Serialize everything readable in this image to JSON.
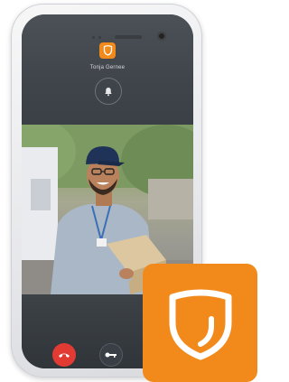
{
  "intercom": {
    "caller_name": "Tonja Gernee",
    "icons": {
      "top_logo": "shield-logo-icon",
      "bell": "bell-icon",
      "end_call": "phone-hangup-icon",
      "key": "key-icon",
      "accept": "phone-icon",
      "badge": "shield-logo-icon"
    }
  },
  "colors": {
    "brand_orange": "#f28a1b",
    "end_call_red": "#e23b33",
    "accept_green": "#2f9f4e"
  }
}
